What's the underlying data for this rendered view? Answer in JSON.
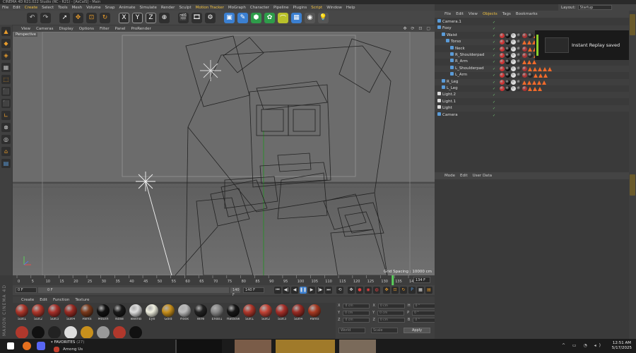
{
  "title_bar": "CINEMA 4D R21.022 Studio (RC - R21) - [AsCalS] - Main",
  "menu": [
    "File",
    "Edit",
    "Create",
    "Select",
    "Tools",
    "Mesh",
    "Volume",
    "Snap",
    "Animate",
    "Simulate",
    "Render",
    "Sculpt",
    "Motion Tracker",
    "MoGraph",
    "Character",
    "Pipeline",
    "Plugins",
    "Script",
    "Window",
    "Help"
  ],
  "layout": {
    "label": "Layout:",
    "value": "Startup"
  },
  "viewport": {
    "menu": [
      "View",
      "Cameras",
      "Display",
      "Options",
      "Filter",
      "Panel",
      "ProRender"
    ],
    "label": "Perspective",
    "grid_spacing": "Grid Spacing : 10000 cm"
  },
  "timeline": {
    "ticks": [
      "0",
      "5",
      "10",
      "15",
      "20",
      "25",
      "30",
      "35",
      "40",
      "45",
      "50",
      "55",
      "60",
      "65",
      "70",
      "75",
      "80",
      "85",
      "90",
      "95",
      "100",
      "105",
      "110",
      "115",
      "120",
      "125",
      "130",
      "135",
      "140"
    ],
    "current_frame": "134 F"
  },
  "transport": {
    "start": "0 F",
    "current": "0 F",
    "end": "140 F",
    "max": "140 F"
  },
  "materials": {
    "menu": [
      "Create",
      "Edit",
      "Function",
      "Texture"
    ],
    "items": [
      {
        "label": "Suit1",
        "color": "#b0382c"
      },
      {
        "label": "Suit2",
        "color": "#b0382c"
      },
      {
        "label": "Suit3",
        "color": "#a8302a"
      },
      {
        "label": "Suit4",
        "color": "#9a2c24"
      },
      {
        "label": "Pants",
        "color": "#7a3a1c"
      },
      {
        "label": "Mouth",
        "color": "#111111"
      },
      {
        "label": "Nose",
        "color": "#1a1a1a"
      },
      {
        "label": "TeethB",
        "color": "#dddddd"
      },
      {
        "label": "Eye",
        "color": "#f0f0e0"
      },
      {
        "label": "Gold",
        "color": "#c8901c"
      },
      {
        "label": "Hook",
        "color": "#bbbbbb"
      },
      {
        "label": "Wire",
        "color": "#222222"
      },
      {
        "label": "Endo1",
        "color": "#888888"
      },
      {
        "label": "HatBow",
        "color": "#161616"
      },
      {
        "label": "Suit1",
        "color": "#b0382c"
      },
      {
        "label": "Suit2",
        "color": "#c44436"
      },
      {
        "label": "Suit3",
        "color": "#a8302a"
      },
      {
        "label": "Suit4",
        "color": "#9a2c24"
      },
      {
        "label": "Pants",
        "color": "#a83a22"
      }
    ]
  },
  "maxon_text": "MAXON CINEMA 4D",
  "coords": {
    "rows": [
      [
        "X",
        "0 cm",
        "X",
        "0 cm",
        "H",
        "0 °"
      ],
      [
        "Y",
        "0 cm",
        "Y",
        "0 cm",
        "P",
        "0 °"
      ],
      [
        "Z",
        "0 cm",
        "Z",
        "0 cm",
        "B",
        "0 °"
      ]
    ],
    "mode": "World",
    "size": "Scale",
    "apply": "Apply"
  },
  "objects": {
    "menu": [
      "File",
      "Edit",
      "View",
      "Objects",
      "Tags",
      "Bookmarks"
    ],
    "items": [
      {
        "name": "Camera.1",
        "indent": 0
      },
      {
        "name": "Foxy",
        "indent": 0
      },
      {
        "name": "Waist",
        "indent": 1
      },
      {
        "name": "Torso",
        "indent": 2
      },
      {
        "name": "Neck",
        "indent": 3
      },
      {
        "name": "R_Shoulderpad",
        "indent": 3
      },
      {
        "name": "R_Arm",
        "indent": 3
      },
      {
        "name": "L_Shoulderpad",
        "indent": 3
      },
      {
        "name": "L_Arm",
        "indent": 3
      },
      {
        "name": "R_Leg",
        "indent": 1
      },
      {
        "name": "L_Leg",
        "indent": 1
      },
      {
        "name": "Light.2",
        "indent": 0
      },
      {
        "name": "Light.1",
        "indent": 0
      },
      {
        "name": "Light",
        "indent": 0
      },
      {
        "name": "Camera",
        "indent": 0
      }
    ]
  },
  "replay_toast": "Instant Replay saved",
  "attributes": {
    "menu": [
      "Mode",
      "Edit",
      "User Data"
    ]
  },
  "taskbar": {
    "favorites": "FAVORITES",
    "favorites_count": "(27)",
    "game": "Among Us",
    "time": "12:51 AM",
    "date": "5/17/2025"
  }
}
